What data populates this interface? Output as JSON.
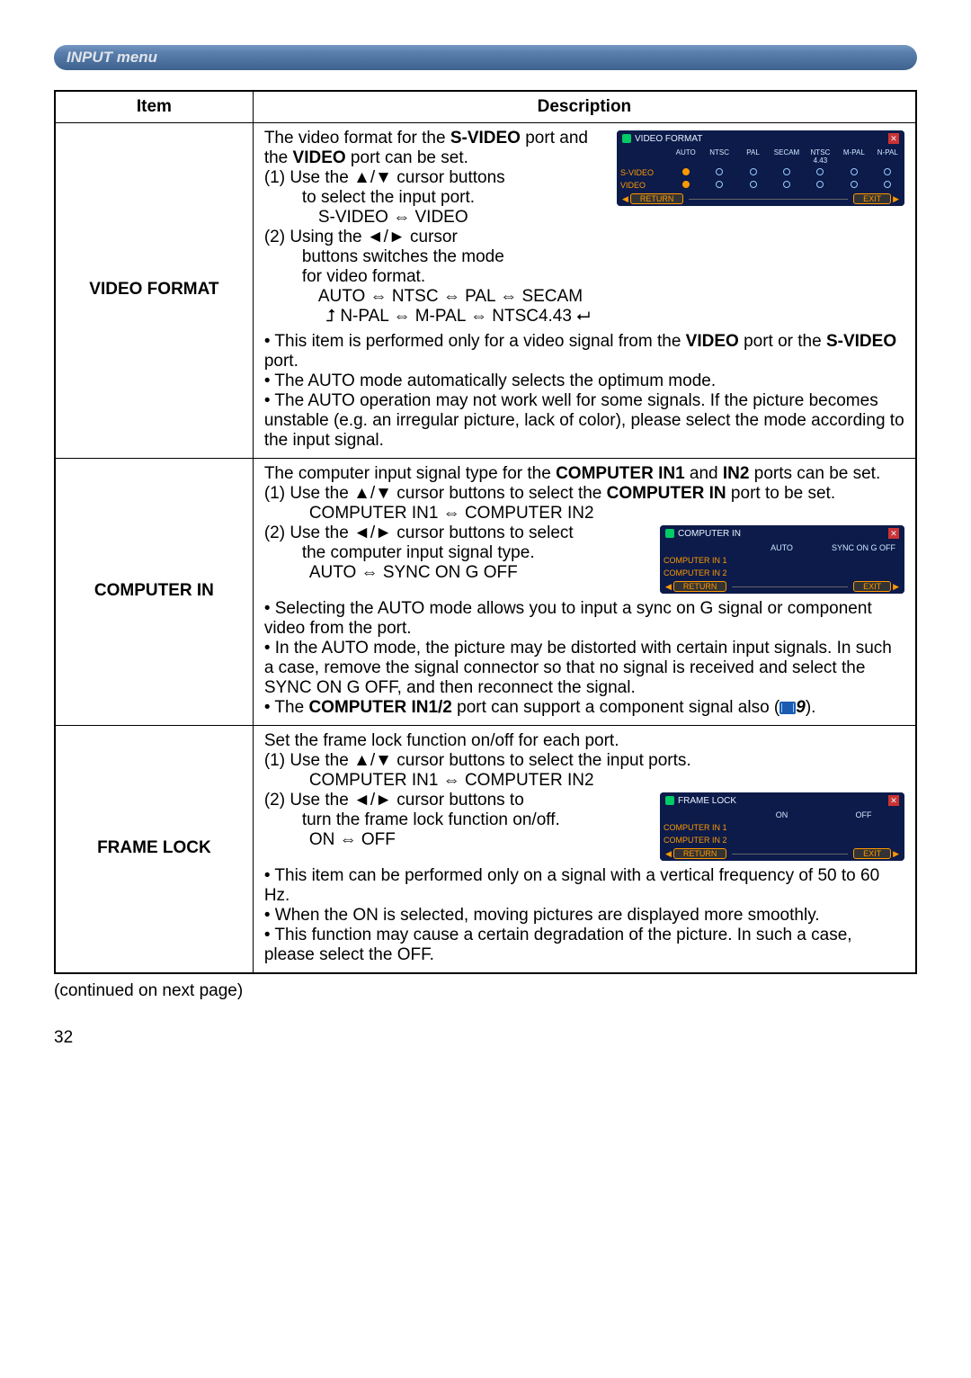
{
  "header": {
    "menu_label": "INPUT menu"
  },
  "table": {
    "col_item": "Item",
    "col_desc": "Description"
  },
  "video_format": {
    "title": "VIDEO FORMAT",
    "intro_a": "The video format for the ",
    "intro_b": " port and the ",
    "intro_c": " port can be set.",
    "port1": "S-VIDEO",
    "port2": "VIDEO",
    "step1a": "(1) Use the ▲/▼ cursor buttons",
    "step1b": "to select the input port.",
    "seq1": "S-VIDEO ⇔ VIDEO",
    "step2a": "(2) Using the ◄/► cursor",
    "step2b": "buttons switches the mode",
    "step2c": "for video format.",
    "seq_top": "AUTO  ⇔  NTSC  ⇔  PAL  ⇔  SECAM",
    "seq_bot": "N-PAL ⇔ M-PAL ⇔ NTSC4.43",
    "loop_l": "⮥",
    "loop_r": "⮠",
    "note1a": "• This item is performed only for a video signal from the ",
    "note1b": " port or the ",
    "note1c": " port.",
    "note2": "• The AUTO mode automatically selects the optimum mode.",
    "note3": "• The AUTO operation may not work well for some signals. If the picture becomes unstable (e.g. an irregular picture, lack of color), please select the mode according to the input signal."
  },
  "computer_in": {
    "title": "COMPUTER IN",
    "intro_a": "The computer input signal type for the ",
    "intro_b": " and ",
    "intro_c": " ports can be set.",
    "port1": "COMPUTER IN1",
    "port2": "IN2",
    "step1a": "(1) Use the ▲/▼ cursor buttons to select the ",
    "step1b": " port to be set.",
    "port_sel": "COMPUTER IN",
    "seq1": "COMPUTER IN1 ⇔ COMPUTER IN2",
    "step2a": "(2) Use the ◄/► cursor buttons to select",
    "step2b": "the computer input signal type.",
    "seq2": "AUTO ⇔ SYNC ON G OFF",
    "note1": "• Selecting the AUTO mode allows you to input a sync on G signal or component video from the port.",
    "note2": "• In the AUTO mode, the picture may be distorted with certain input signals. In such a case, remove the signal connector so that no signal is received and select the SYNC ON G OFF, and then reconnect the signal.",
    "note3a": "• The ",
    "note3b": " port can support a component signal also (",
    "note3c": ").",
    "port_full": "COMPUTER IN1/2",
    "ref": "9"
  },
  "frame_lock": {
    "title": "FRAME LOCK",
    "intro": "Set the frame lock function on/off for each port.",
    "step1": "(1) Use the ▲/▼ cursor buttons to select the input ports.",
    "seq1": "COMPUTER IN1 ⇔ COMPUTER IN2",
    "step2a": "(2) Use the ◄/► cursor buttons to",
    "step2b": "turn the frame lock function on/off.",
    "seq2": "ON ⇔ OFF",
    "note1": "• This item can be performed only on a signal with a vertical frequency of 50 to 60 Hz.",
    "note2": "• When the ON is selected, moving pictures are displayed more smoothly.",
    "note3": "• This function may cause a certain degradation of the picture. In such a case, please select the OFF."
  },
  "osd1": {
    "title": "VIDEO FORMAT",
    "cols": [
      "AUTO",
      "NTSC",
      "PAL",
      "SECAM",
      "NTSC 4.43",
      "M-PAL",
      "N-PAL"
    ],
    "rows": [
      "S-VIDEO",
      "VIDEO"
    ],
    "return": "RETURN",
    "exit": "EXIT"
  },
  "osd2": {
    "title": "COMPUTER IN",
    "cols": [
      "AUTO",
      "SYNC ON G OFF"
    ],
    "rows": [
      "COMPUTER IN 1",
      "COMPUTER IN 2"
    ],
    "return": "RETURN",
    "exit": "EXIT"
  },
  "osd3": {
    "title": "FRAME LOCK",
    "cols": [
      "ON",
      "OFF"
    ],
    "rows": [
      "COMPUTER IN 1",
      "COMPUTER IN 2"
    ],
    "return": "RETURN",
    "exit": "EXIT"
  },
  "footer": {
    "continued": "(continued on next page)",
    "page": "32"
  }
}
